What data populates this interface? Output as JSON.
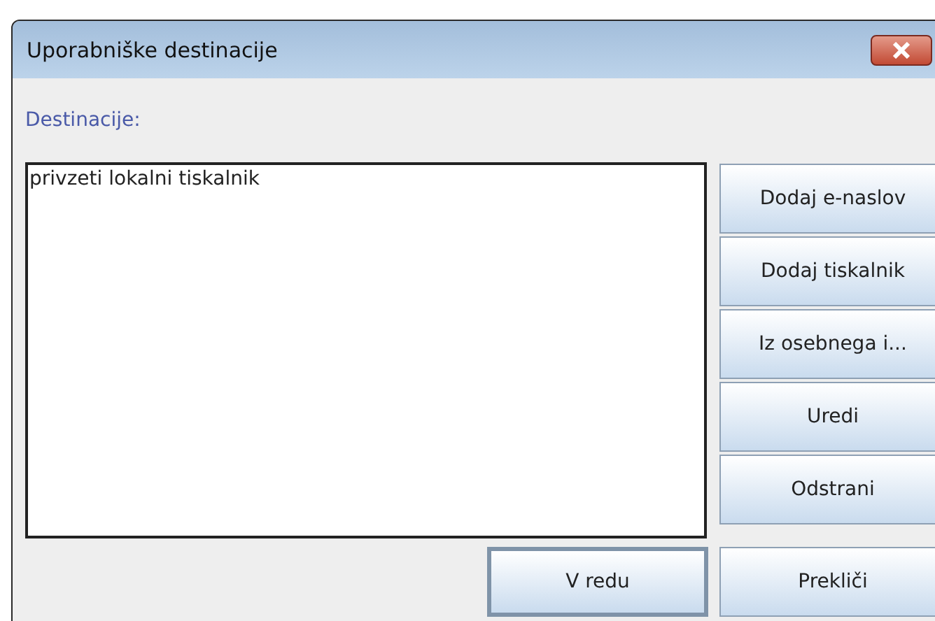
{
  "window": {
    "title": "Uporabniške destinacije"
  },
  "label": "Destinacije:",
  "destinations": [
    {
      "name": "privzeti lokalni tiskalnik",
      "selected": false
    }
  ],
  "side_buttons": [
    "Dodaj e-naslov",
    "Dodaj tiskalnik",
    "Iz osebnega i...",
    "Uredi",
    "Odstrani"
  ],
  "dialog_buttons": [
    {
      "label": "V redu",
      "default": true
    },
    {
      "label": "Prekliči",
      "default": false
    }
  ]
}
